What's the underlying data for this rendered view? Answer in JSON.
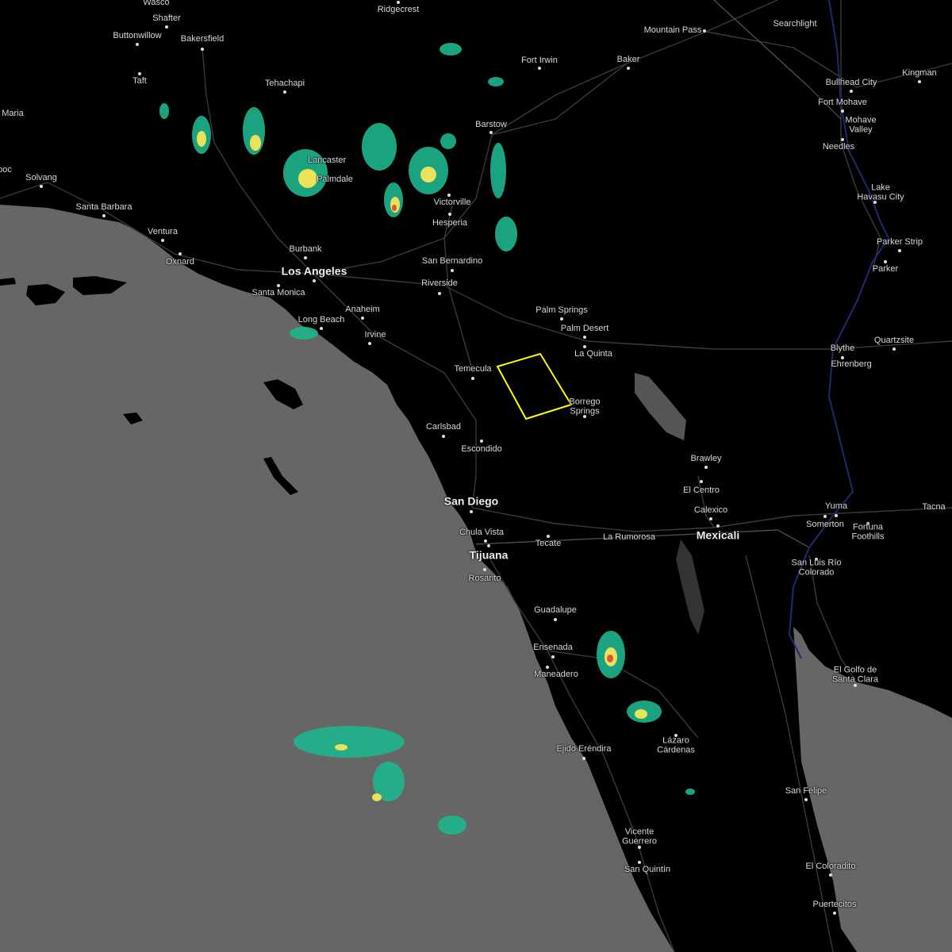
{
  "map": {
    "colors": {
      "ocean": "#666666",
      "land": "#000000",
      "roads": "#3a3a3a",
      "borders": "#555555",
      "river": "#1f2a6e",
      "warning_box": "#ffff00"
    },
    "cities": [
      {
        "id": "ridgecrest",
        "label": "Ridgecrest"
      },
      {
        "id": "wasco",
        "label": "Wasco"
      },
      {
        "id": "shafter",
        "label": "Shafter"
      },
      {
        "id": "buttonwillow",
        "label": "Buttonwillow"
      },
      {
        "id": "bakersfield",
        "label": "Bakersfield",
        "big": false
      },
      {
        "id": "taft",
        "label": "Taft"
      },
      {
        "id": "maria",
        "label": "Maria"
      },
      {
        "id": "tehachapi",
        "label": "Tehachapi"
      },
      {
        "id": "lancaster",
        "label": "Lancaster"
      },
      {
        "id": "palmdale",
        "label": "Palmdale"
      },
      {
        "id": "solvang",
        "label": "Solvang"
      },
      {
        "id": "lompoc",
        "label": "poc"
      },
      {
        "id": "santabarbara",
        "label": "Santa Barbara"
      },
      {
        "id": "ventura",
        "label": "Ventura"
      },
      {
        "id": "oxnard",
        "label": "Oxnard"
      },
      {
        "id": "burbank",
        "label": "Burbank"
      },
      {
        "id": "losangeles",
        "label": "Los Angeles",
        "big": true
      },
      {
        "id": "santamonica",
        "label": "Santa Monica"
      },
      {
        "id": "anaheim",
        "label": "Anaheim"
      },
      {
        "id": "longbeach",
        "label": "Long Beach"
      },
      {
        "id": "irvine",
        "label": "Irvine"
      },
      {
        "id": "sanbernardino",
        "label": "San Bernardino"
      },
      {
        "id": "riverside",
        "label": "Riverside"
      },
      {
        "id": "hesperia",
        "label": "Hesperia"
      },
      {
        "id": "victorville",
        "label": "Victorville"
      },
      {
        "id": "barstow",
        "label": "Barstow"
      },
      {
        "id": "fortirwin",
        "label": "Fort Irwin"
      },
      {
        "id": "baker",
        "label": "Baker"
      },
      {
        "id": "mountainpass",
        "label": "Mountain Pass"
      },
      {
        "id": "searchlight",
        "label": "Searchlight"
      },
      {
        "id": "bullhead",
        "label": "Bullhead City"
      },
      {
        "id": "kingman",
        "label": "Kingman"
      },
      {
        "id": "fortmohave",
        "label": "Fort Mohave"
      },
      {
        "id": "mohavevalley",
        "label": "Mohave\nValley"
      },
      {
        "id": "needles",
        "label": "Needles"
      },
      {
        "id": "lakehavasu",
        "label": "Lake\nHavasu City"
      },
      {
        "id": "parkerstrip",
        "label": "Parker Strip"
      },
      {
        "id": "parker",
        "label": "Parker"
      },
      {
        "id": "palmsprings",
        "label": "Palm Springs"
      },
      {
        "id": "palmdesert",
        "label": "Palm Desert"
      },
      {
        "id": "laquinta",
        "label": "La Quinta"
      },
      {
        "id": "blythe",
        "label": "Blythe"
      },
      {
        "id": "ehrenberg",
        "label": "Ehrenberg"
      },
      {
        "id": "quartzsite",
        "label": "Quartzsite"
      },
      {
        "id": "temecula",
        "label": "Temecula"
      },
      {
        "id": "borrego",
        "label": "Borrego\nSprings"
      },
      {
        "id": "carlsbad",
        "label": "Carlsbad"
      },
      {
        "id": "escondido",
        "label": "Escondido"
      },
      {
        "id": "sandiego",
        "label": "San Diego",
        "big": true
      },
      {
        "id": "chulavista",
        "label": "Chula Vista"
      },
      {
        "id": "tijuana",
        "label": "Tijuana",
        "big": true
      },
      {
        "id": "rosarito",
        "label": "Rosarito"
      },
      {
        "id": "tecate",
        "label": "Tecate"
      },
      {
        "id": "larumorosa",
        "label": "La Rumorosa"
      },
      {
        "id": "mexicali",
        "label": "Mexicali",
        "big": true
      },
      {
        "id": "calexico",
        "label": "Calexico"
      },
      {
        "id": "elcentro",
        "label": "El Centro"
      },
      {
        "id": "brawley",
        "label": "Brawley"
      },
      {
        "id": "yuma",
        "label": "Yuma",
        "big": false
      },
      {
        "id": "somerton",
        "label": "Somerton"
      },
      {
        "id": "fortuna",
        "label": "Fortuna\nFoothills"
      },
      {
        "id": "tacna",
        "label": "Tacna"
      },
      {
        "id": "sanluis",
        "label": "San Luis Río\nColorado"
      },
      {
        "id": "guadalupe",
        "label": "Guadalupe"
      },
      {
        "id": "ensenada",
        "label": "Ensenada",
        "big": false
      },
      {
        "id": "maneadero",
        "label": "Maneadero"
      },
      {
        "id": "elgolfo",
        "label": "El Golfo de\nSanta Clara"
      },
      {
        "id": "ejido",
        "label": "Ejido Eréndira"
      },
      {
        "id": "lazaro",
        "label": "Lázaro\nCárdenas"
      },
      {
        "id": "sanfelipe",
        "label": "San Felipe"
      },
      {
        "id": "vicente",
        "label": "Vicente\nGuerrero"
      },
      {
        "id": "sanquintin",
        "label": "San Quintín"
      },
      {
        "id": "elcoloradito",
        "label": "El Coloradito"
      },
      {
        "id": "puertecitos",
        "label": "Puertecitos"
      }
    ]
  }
}
